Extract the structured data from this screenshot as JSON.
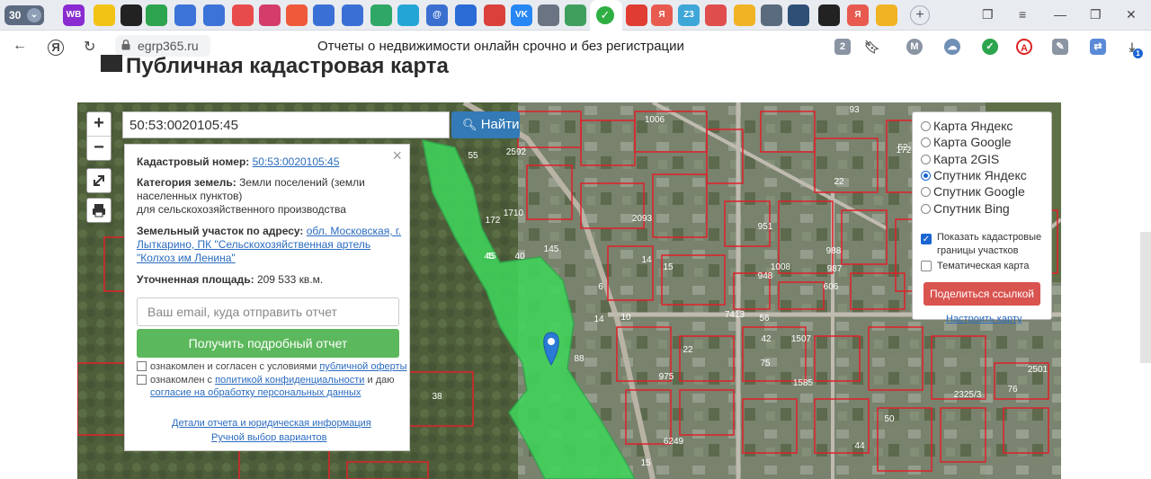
{
  "browser": {
    "tab_count": "30",
    "tabs": [
      {
        "label": "WB",
        "color": "#8a2bd1"
      },
      {
        "label": "",
        "color": "#f2c314"
      },
      {
        "label": "",
        "color": "#222"
      },
      {
        "label": "",
        "color": "#2da44e"
      },
      {
        "label": "",
        "color": "#3b73d8"
      },
      {
        "label": "",
        "color": "#3b73d8"
      },
      {
        "label": "",
        "color": "#e84b4b"
      },
      {
        "label": "",
        "color": "#d43d6b"
      },
      {
        "label": "",
        "color": "#ef5a3a"
      },
      {
        "label": "",
        "color": "#3a70d6"
      },
      {
        "label": "",
        "color": "#3a70d6"
      },
      {
        "label": "",
        "color": "#2ea864"
      },
      {
        "label": "",
        "color": "#23a6d5"
      },
      {
        "label": "@",
        "color": "#3a6fd0"
      },
      {
        "label": "",
        "color": "#2a6bd6"
      },
      {
        "label": "",
        "color": "#d9413a"
      },
      {
        "label": "VK",
        "color": "#2787f5"
      },
      {
        "label": "",
        "color": "#6a7482"
      },
      {
        "label": "",
        "color": "#3fa05e"
      }
    ],
    "tabs_right": [
      {
        "label": "",
        "color": "#e03c31"
      },
      {
        "label": "Я",
        "color": "#e85a4f"
      },
      {
        "label": "Z3",
        "color": "#3fa6d8"
      },
      {
        "label": "",
        "color": "#e04d4d"
      },
      {
        "label": "",
        "color": "#f0b323"
      },
      {
        "label": "",
        "color": "#5b6b7e"
      },
      {
        "label": "",
        "color": "#2f4f77"
      },
      {
        "label": "",
        "color": "#222"
      },
      {
        "label": "Я",
        "color": "#e85a4f"
      },
      {
        "label": "",
        "color": "#f0b323"
      }
    ],
    "url": "egrp365.ru",
    "page_title": "Отчеты о недвижимости онлайн срочно и без регистрации",
    "ext_badge_1": "2",
    "ext_badge_2": "1",
    "profile_letter": "M"
  },
  "page": {
    "heading": "Публичная кадастровая карта"
  },
  "map": {
    "search_value": "50:53:0020105:45",
    "search_button": "Найти",
    "zoom_in": "+",
    "zoom_out": "−",
    "info": {
      "cad_label": "Кадастровый номер:",
      "cad_value": "50:53:0020105:45",
      "category_label": "Категория земель:",
      "category_value": "Земли поселений (земли населенных пунктов)",
      "category_value2": "для сельскохозяйственного производства",
      "address_label": "Земельный участок по адресу:",
      "address_value": "обл. Московская, г. Лыткарино, ПК \"Сельскохозяйственная артель \"Колхоз им Ленина\"",
      "area_label": "Уточненная площадь:",
      "area_value": "209 533 кв.м.",
      "email_placeholder": "Ваш email, куда отправить отчет",
      "report_button": "Получить подробный отчет",
      "consent1_pre": "ознакомлен и согласен с условиями ",
      "consent1_link": "публичной оферты",
      "consent2_pre": "ознакомлен с ",
      "consent2_link": "политикой конфиденциальности",
      "consent2_mid": " и даю",
      "consent2_link2": "согласие на обработку персональных данных",
      "details_link": "Детали отчета и юридическая информация",
      "manual_link": "Ручной выбор вариантов"
    },
    "layers": {
      "options": [
        {
          "label": "Карта Яндекс",
          "selected": false
        },
        {
          "label": "Карта Google",
          "selected": false
        },
        {
          "label": "Карта 2GIS",
          "selected": false
        },
        {
          "label": "Спутник Яндекс",
          "selected": true
        },
        {
          "label": "Спутник Google",
          "selected": false
        },
        {
          "label": "Спутник Bing",
          "selected": false
        }
      ],
      "show_borders_label": "Показать кадастровые границы участков",
      "show_borders_checked": true,
      "thematic_label": "Тематическая карта",
      "thematic_checked": false,
      "share_button": "Поделиться ссылкой",
      "configure_link": "Настроить карту"
    },
    "parcel_labels": [
      "1006",
      "2592",
      "55",
      "45",
      "40",
      "1710",
      "172",
      "145",
      "2093",
      "14",
      "15",
      "6",
      "14",
      "10",
      "7413",
      "56",
      "948",
      "1008",
      "988",
      "987",
      "606",
      "22",
      "42",
      "1507",
      "975",
      "75",
      "1585",
      "88",
      "38",
      "2325/3",
      "76",
      "2501",
      "50",
      "44",
      "6249",
      "15",
      "45",
      "951",
      "22",
      "52",
      "93",
      "172",
      "20"
    ],
    "colors": {
      "parcel_fill": "#3fd45a",
      "parcel_border": "#e0202a"
    }
  }
}
